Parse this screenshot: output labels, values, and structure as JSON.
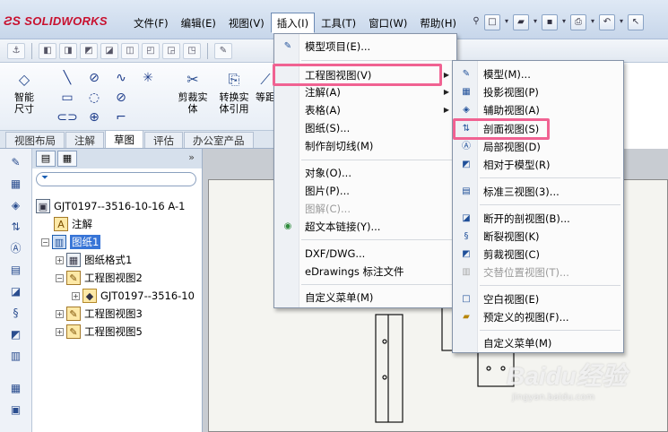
{
  "app": {
    "logo": "SOLIDWORKS"
  },
  "menubar": {
    "items": [
      "文件(F)",
      "编辑(E)",
      "视图(V)",
      "插入(I)",
      "工具(T)",
      "窗口(W)",
      "帮助(H)"
    ],
    "active_index": 3
  },
  "command_manager": {
    "smart_dim": "智能尺寸",
    "trim": "剪裁实体",
    "convert": "转换实体引用",
    "offset": "等距"
  },
  "tabs": [
    "视图布局",
    "注解",
    "草图",
    "评估",
    "办公室产品"
  ],
  "active_tab": "草图",
  "tree": {
    "root": "GJT0197--3516-10-16 A-1",
    "annotations": "注解",
    "sheet": "图纸1",
    "sheet_format": "图纸格式1",
    "view2": "工程图视图2",
    "view2_child": "GJT0197--3516-10",
    "view3": "工程图视图3",
    "view5": "工程图视图5"
  },
  "insert_menu": [
    {
      "label": "模型项目(E)...",
      "icon": "model-items"
    },
    {
      "label": "工程图视图(V)",
      "sub": true
    },
    {
      "label": "注解(A)",
      "sub": true
    },
    {
      "label": "表格(A)",
      "sub": true
    },
    {
      "label": "图纸(S)..."
    },
    {
      "label": "制作剖切线(M)"
    },
    {
      "label": "对象(O)..."
    },
    {
      "label": "图片(P)..."
    },
    {
      "label": "图解(C)...",
      "disabled": true
    },
    {
      "label": "超文本链接(Y)...",
      "icon": "globe"
    },
    {
      "label": "DXF/DWG..."
    },
    {
      "label": "eDrawings 标注文件"
    },
    {
      "label": "自定义菜单(M)"
    }
  ],
  "drawing_view_menu": [
    {
      "label": "模型(M)..."
    },
    {
      "label": "投影视图(P)"
    },
    {
      "label": "辅助视图(A)"
    },
    {
      "label": "剖面视图(S)"
    },
    {
      "label": "局部视图(D)"
    },
    {
      "label": "相对于模型(R)"
    },
    {
      "label": "标准三视图(3)..."
    },
    {
      "label": "断开的剖视图(B)..."
    },
    {
      "label": "断裂视图(K)"
    },
    {
      "label": "剪裁视图(C)"
    },
    {
      "label": "交替位置视图(T)...",
      "disabled": true
    },
    {
      "label": "空白视图(E)"
    },
    {
      "label": "预定义的视图(F)..."
    },
    {
      "label": "自定义菜单(M)"
    }
  ],
  "highlight_color": "#f06292",
  "watermark": {
    "brand": "Baidu经验",
    "url": "jingyan.baidu.com"
  }
}
